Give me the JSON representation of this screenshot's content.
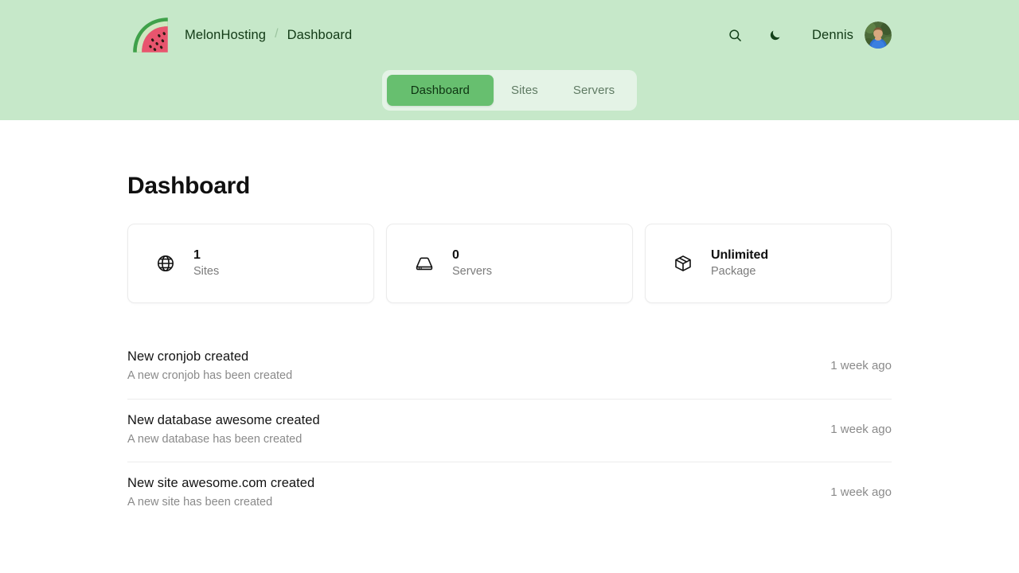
{
  "header": {
    "logo_icon": "watermelon-slice-icon",
    "breadcrumb": {
      "root": "MelonHosting",
      "separator": "/",
      "current": "Dashboard"
    },
    "actions": {
      "search_icon": "search-icon",
      "theme_toggle_icon": "moon-icon"
    },
    "user": {
      "name": "Dennis",
      "avatar_icon": "user-avatar-photo"
    },
    "background_color": "#c6e8c9"
  },
  "tabs": {
    "active_index": 0,
    "items": [
      {
        "label": "Dashboard"
      },
      {
        "label": "Sites"
      },
      {
        "label": "Servers"
      }
    ],
    "active_color": "#67bf6f",
    "container_color": "#e4f3e6"
  },
  "main": {
    "page_title": "Dashboard",
    "stats": [
      {
        "icon": "globe-icon",
        "value": "1",
        "label": "Sites"
      },
      {
        "icon": "server-icon",
        "value": "0",
        "label": "Servers"
      },
      {
        "icon": "package-box-icon",
        "value": "Unlimited",
        "label": "Package"
      }
    ],
    "activity": [
      {
        "title": "New cronjob created",
        "description": "A new cronjob has been created",
        "time": "1 week ago"
      },
      {
        "title": "New database awesome created",
        "description": "A new database has been created",
        "time": "1 week ago"
      },
      {
        "title": "New site awesome.com created",
        "description": "A new site has been created",
        "time": "1 week ago"
      }
    ]
  }
}
